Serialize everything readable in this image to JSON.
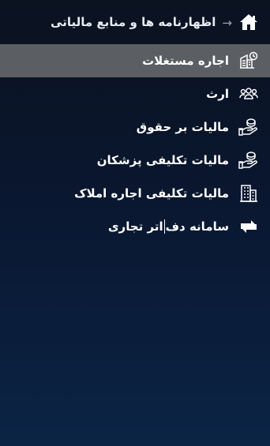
{
  "header": {
    "title": "اظهارنامه ها و منابع مالیاتی",
    "arrow": "→",
    "home_icon": "home-icon"
  },
  "menu": {
    "items": [
      {
        "label": "اجاره مستغلات",
        "icon": "building-clock-icon",
        "active": true
      },
      {
        "label": "ارث",
        "icon": "people-group-icon",
        "active": false
      },
      {
        "label": "مالیات بر حقوق",
        "icon": "hand-coin-icon",
        "active": false
      },
      {
        "label": "مالیات تکلیفی پزشکان",
        "icon": "hand-coin-icon",
        "active": false
      },
      {
        "label": "مالیات تکلیفی اجاره املاک",
        "icon": "building-icon",
        "active": false
      },
      {
        "label_part1": "سامانه دف",
        "label_part2": "اتر تجاری",
        "icon": "exchange-arrows-icon",
        "active": false
      }
    ]
  },
  "colors": {
    "active_bg": "#5b5e63",
    "background_top": "#0b1220",
    "background_bottom": "#0b2445",
    "text": "#ffffff"
  }
}
